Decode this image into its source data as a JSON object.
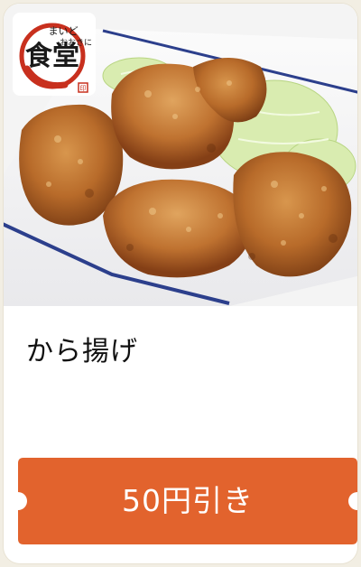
{
  "card": {
    "title": "から揚げ",
    "photo_subject": "fried chicken (karaage) on plate with shredded cabbage",
    "logo": {
      "text": "まいどおおきに食堂",
      "color": "#c8301e"
    }
  },
  "coupon": {
    "label": "50円引き",
    "color": "#e2632d"
  }
}
